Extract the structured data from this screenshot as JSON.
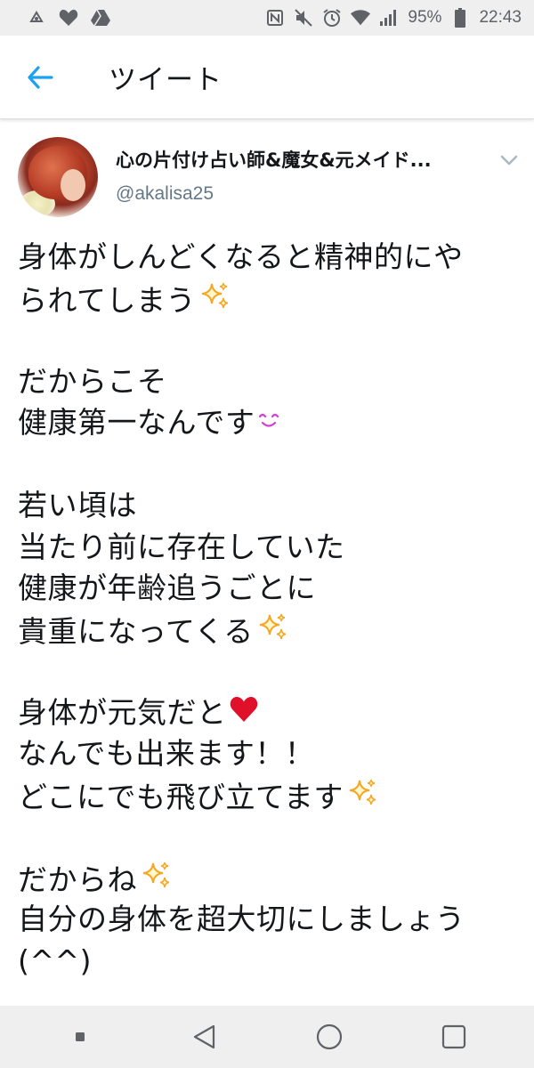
{
  "status_bar": {
    "battery": "95%",
    "time": "22:43"
  },
  "toolbar": {
    "title": "ツイート"
  },
  "tweet": {
    "display_name": "心の片付け占い師&魔女&元メイド...",
    "handle": "@akalisa25",
    "lines": [
      "身体がしんどくなると精神的にや",
      "られてしまう",
      "",
      "だからこそ",
      "健康第一なんです",
      "",
      "若い頃は",
      "当たり前に存在していた",
      "健康が年齢追うごとに",
      "貴重になってくる",
      "",
      "身体が元気だと",
      "なんでも出来ます！！",
      "どこにでも飛び立てます",
      "",
      "だからね",
      "自分の身体を超大切にしましょう",
      "(^^)"
    ]
  },
  "icons": {
    "back": "arrow-left-icon",
    "caret": "chevron-down-icon",
    "sparkle": "sparkles-icon",
    "heart": "heart-icon",
    "smile": "smile-icon"
  },
  "colors": {
    "accent": "#1da1f2",
    "sparkle": "#f5a623",
    "heart": "#e0102a",
    "smile": "#d63bd6",
    "handle": "#657786"
  }
}
